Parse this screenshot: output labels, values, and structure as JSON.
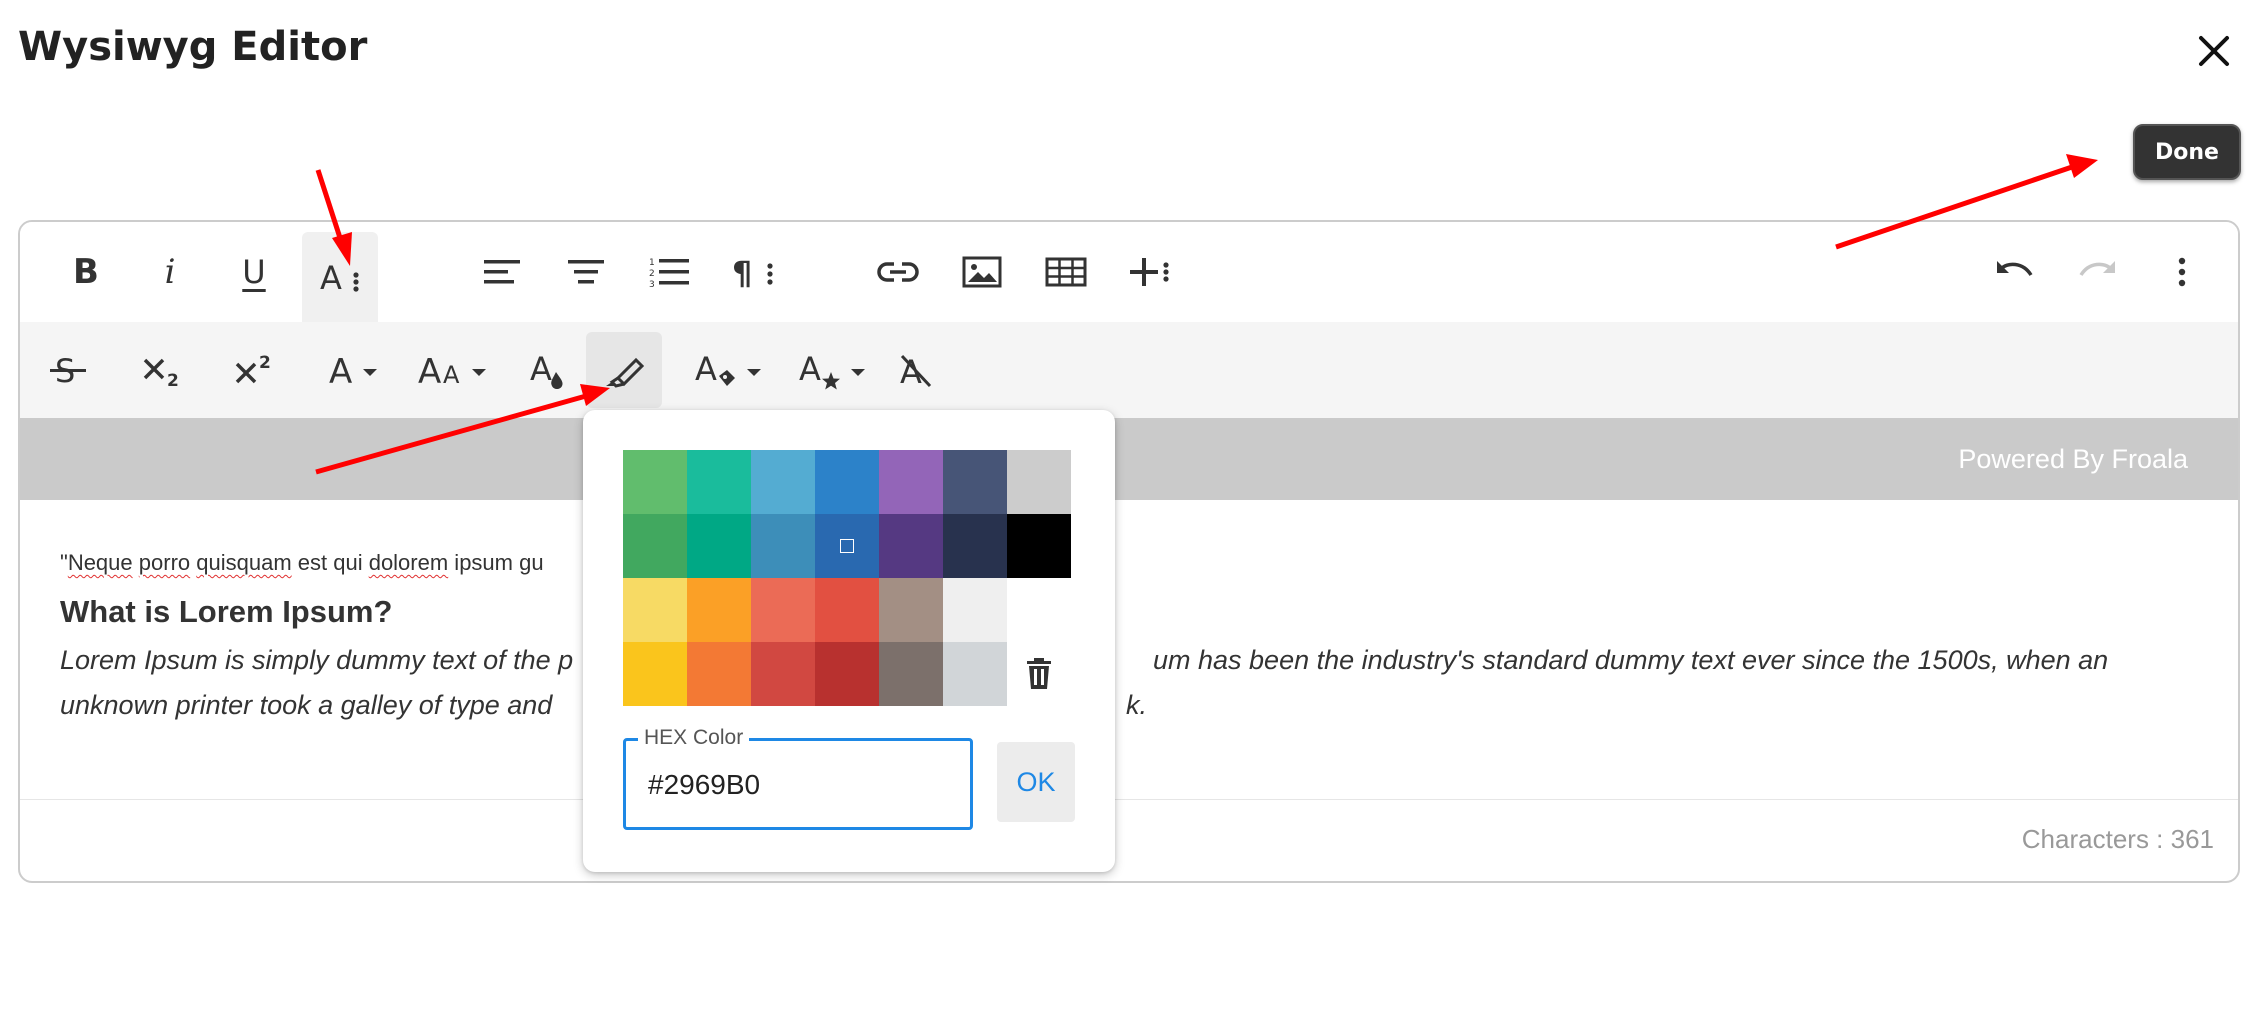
{
  "app": {
    "title": "Wysiwyg Editor"
  },
  "actions": {
    "done_label": "Done",
    "close_icon": "close-icon"
  },
  "toolbar": {
    "row1": [
      {
        "name": "bold-button",
        "icon": "bold-icon",
        "glyph": "B"
      },
      {
        "name": "italic-button",
        "icon": "italic-icon",
        "glyph": "i"
      },
      {
        "name": "underline-button",
        "icon": "underline-icon",
        "glyph": "U"
      },
      {
        "name": "more-text-button",
        "icon": "text-more-icon",
        "glyph": "A"
      },
      {
        "name": "align-left-button",
        "icon": "align-left-icon"
      },
      {
        "name": "align-center-button",
        "icon": "align-center-icon"
      },
      {
        "name": "ordered-list-button",
        "icon": "ordered-list-icon"
      },
      {
        "name": "paragraph-more-button",
        "icon": "paragraph-icon",
        "glyph": "¶"
      },
      {
        "name": "insert-link-button",
        "icon": "link-icon"
      },
      {
        "name": "insert-image-button",
        "icon": "image-icon"
      },
      {
        "name": "insert-table-button",
        "icon": "table-icon"
      },
      {
        "name": "insert-more-button",
        "icon": "plus-more-icon",
        "glyph": "+"
      },
      {
        "name": "undo-button",
        "icon": "undo-icon"
      },
      {
        "name": "redo-button",
        "icon": "redo-icon"
      },
      {
        "name": "more-options-button",
        "icon": "vertical-dots-icon"
      }
    ],
    "row2": [
      {
        "name": "strikethrough-button",
        "icon": "strikethrough-icon"
      },
      {
        "name": "subscript-button",
        "icon": "subscript-icon"
      },
      {
        "name": "superscript-button",
        "icon": "superscript-icon"
      },
      {
        "name": "font-family-button",
        "icon": "font-family-icon"
      },
      {
        "name": "font-size-button",
        "icon": "font-size-icon"
      },
      {
        "name": "text-color-button",
        "icon": "text-color-icon"
      },
      {
        "name": "background-color-button",
        "icon": "highlighter-icon"
      },
      {
        "name": "inline-class-button",
        "icon": "inline-class-icon"
      },
      {
        "name": "inline-style-button",
        "icon": "inline-style-icon"
      },
      {
        "name": "clear-formatting-button",
        "icon": "clear-format-icon"
      }
    ],
    "colors": {
      "icon": "#333333",
      "active_bg": "#e6e6e6",
      "disabled": "#c8c8c8"
    }
  },
  "powered_by": "Powered By Froala",
  "content": {
    "quote_words": [
      "\"",
      "Neque",
      " ",
      "porro",
      " ",
      "quisquam",
      " est qui ",
      "dolorem",
      " ipsum gu"
    ],
    "heading": "What is Lorem Ipsum?",
    "para_line1_left": "Lorem Ipsum is simply dummy text of the p",
    "para_line1_right": "um has been the industry's standard dummy text ever since the 1500s, when an",
    "para_line2_left": "unknown printer took a galley of type and",
    "para_line2_right": "k."
  },
  "footer": {
    "char_count": "Characters : 361"
  },
  "color_picker": {
    "swatches": [
      "#61BD6D",
      "#1ABC9C",
      "#54ACD2",
      "#2C82C9",
      "#9365B8",
      "#475577",
      "#CCCCCC",
      "#41A85F",
      "#00A885",
      "#3D8EB9",
      "#2969B0",
      "#553982",
      "#28324E",
      "#000000",
      "#F7DA64",
      "#FBA026",
      "#EB6B56",
      "#E25041",
      "#A38F84",
      "#EFEFEF",
      "#FFFFFF",
      "#FAC51C",
      "#F37934",
      "#D14841",
      "#B8312F",
      "#7C706B",
      "#D1D5D8"
    ],
    "selected": "#2969B0",
    "remove_icon": "trash-icon",
    "hex_label": "HEX Color",
    "hex_value": "#2969B0",
    "ok_label": "OK",
    "accent": "#1E88E5"
  },
  "annotations": {
    "arrow_color": "#FF0000"
  }
}
